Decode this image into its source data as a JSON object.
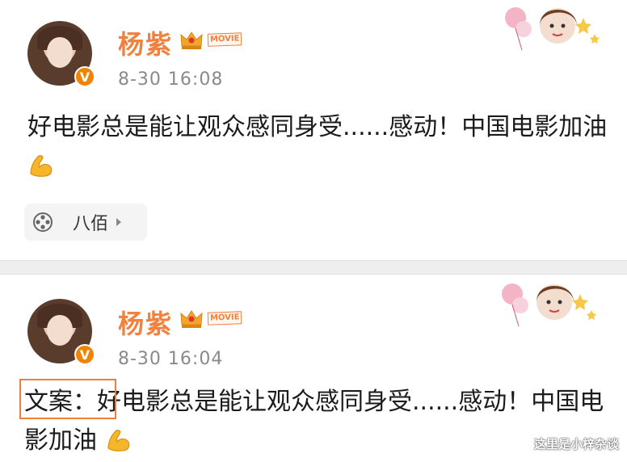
{
  "posts": [
    {
      "user": "杨紫",
      "badge": "MOVIE",
      "verified_mark": "V",
      "time": "8-30 16:08",
      "text": "好电影总是能让观众感同身受......感动！中国电影加油",
      "emoji": "flexed-biceps-icon",
      "repost_label": "八佰"
    },
    {
      "user": "杨紫",
      "badge": "MOVIE",
      "verified_mark": "V",
      "time": "8-30 16:04",
      "prefix": "文案：",
      "text": "好电影总是能让观众感同身受......感动！中国电影加油",
      "emoji": "flexed-biceps-icon"
    }
  ],
  "watermark": "这里是小梓杂谈",
  "colors": {
    "username": "#f1813d",
    "verified_badge": "#f08300",
    "highlight_box": "#ef7d3c",
    "time_text": "#8a8a8a"
  }
}
